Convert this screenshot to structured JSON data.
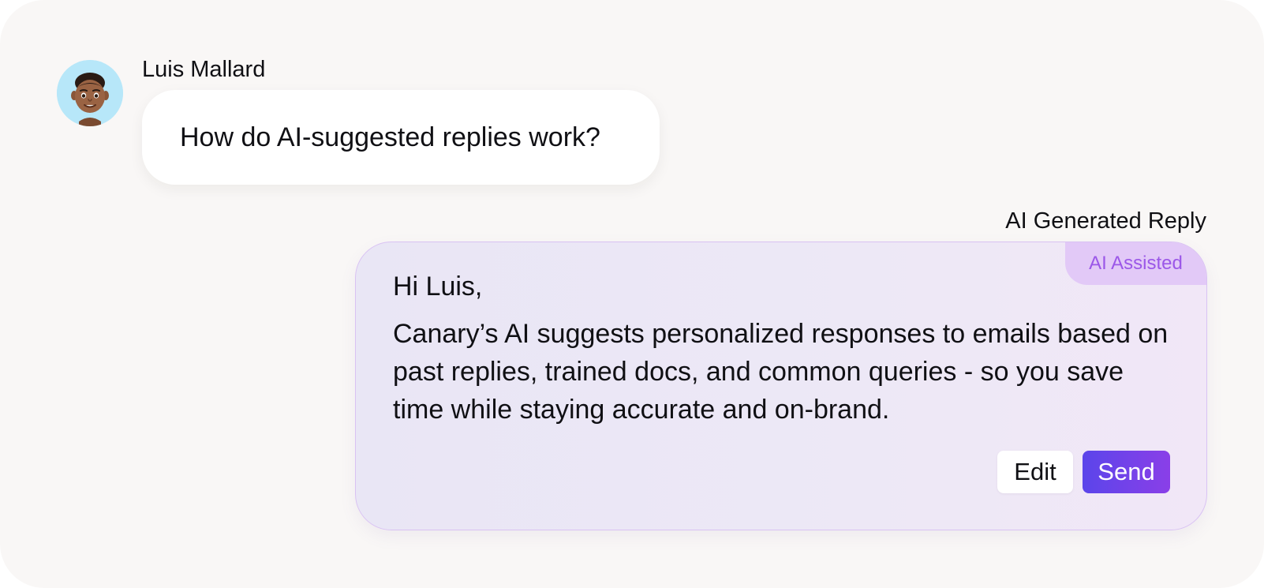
{
  "conversation": {
    "sender": {
      "name": "Luis Mallard",
      "avatar_icon": "memoji-avatar-icon"
    },
    "user_message": "How do AI-suggested replies work?",
    "reply": {
      "section_title": "AI Generated Reply",
      "badge": "AI Assisted",
      "greeting": "Hi Luis,",
      "body": "Canary’s AI suggests personalized responses to emails based on past replies, trained docs, and common queries - so you save time while staying accurate and on-brand.",
      "edit_label": "Edit",
      "send_label": "Send"
    }
  },
  "colors": {
    "page_background": "#f9f7f6",
    "avatar_background": "#b7e7f9",
    "reply_border": "#d9c2f3",
    "badge_background": "#e2c9f7",
    "badge_text": "#9b57e8",
    "send_gradient_start": "#5b45ea",
    "send_gradient_end": "#8a3fe8"
  }
}
